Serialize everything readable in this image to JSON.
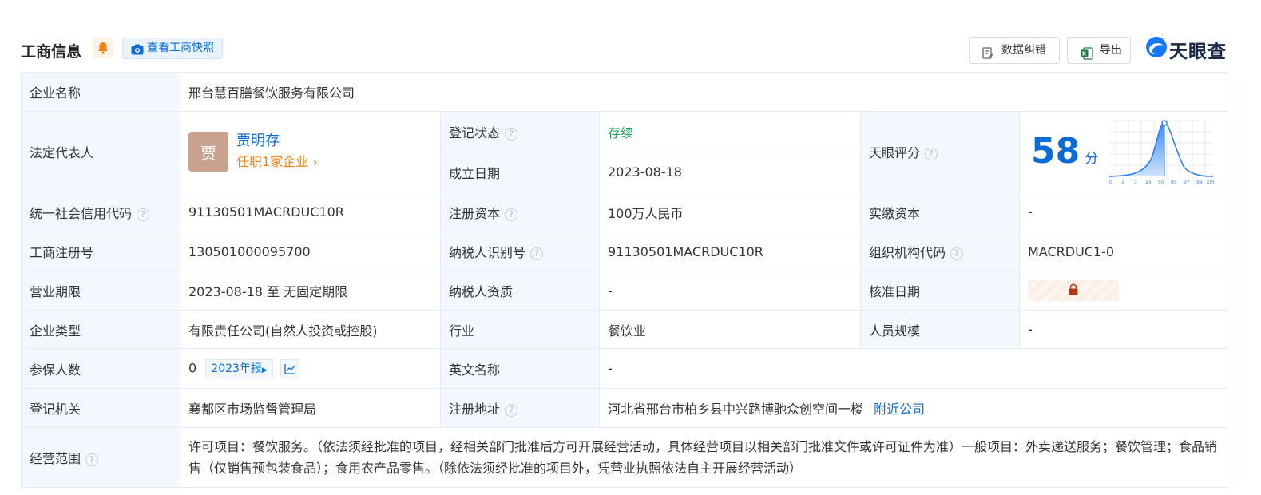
{
  "header": {
    "title": "工商信息",
    "snapshot_label": "查看工商快照",
    "fix_label": "数据纠错",
    "export_label": "导出",
    "logo_text": "天眼查"
  },
  "fields": {
    "company_name_label": "企业名称",
    "company_name": "邢台慧百膳餐饮服务有限公司",
    "legal_rep_label": "法定代表人",
    "legal_rep_avatar": "贾",
    "legal_rep_name": "贾明存",
    "legal_rep_jobs": "任职1家企业",
    "reg_status_label": "登记状态",
    "reg_status": "存续",
    "found_date_label": "成立日期",
    "found_date": "2023-08-18",
    "score_label": "天眼评分",
    "score_value": "58",
    "score_unit": "分",
    "credit_code_label": "统一社会信用代码",
    "credit_code": "91130501MACRDUC10R",
    "reg_capital_label": "注册资本",
    "reg_capital": "100万人民币",
    "paid_capital_label": "实缴资本",
    "paid_capital": "-",
    "reg_no_label": "工商注册号",
    "reg_no": "130501000095700",
    "taxpayer_id_label": "纳税人识别号",
    "taxpayer_id": "91130501MACRDUC10R",
    "org_code_label": "组织机构代码",
    "org_code": "MACRDUC1-0",
    "term_label": "营业期限",
    "term": "2023-08-18 至 无固定期限",
    "tax_qual_label": "纳税人资质",
    "tax_qual": "-",
    "approve_date_label": "核准日期",
    "company_type_label": "企业类型",
    "company_type": "有限责任公司(自然人投资或控股)",
    "industry_label": "行业",
    "industry": "餐饮业",
    "staff_size_label": "人员规模",
    "staff_size": "-",
    "insured_label": "参保人数",
    "insured": "0",
    "insured_report": "2023年报",
    "english_name_label": "英文名称",
    "english_name": "-",
    "authority_label": "登记机关",
    "authority": "襄都区市场监督管理局",
    "address_label": "注册地址",
    "address": "河北省邢台市柏乡县中兴路博驰众创空间一楼",
    "nearby_label": "附近公司",
    "scope_label": "经营范围",
    "scope": "许可项目：餐饮服务。（依法须经批准的项目，经相关部门批准后方可开展经营活动，具体经营项目以相关部门批准文件或许可证件为准）一般项目：外卖递送服务；餐饮管理；食品销售（仅销售预包装食品）；食用农产品零售。（除依法须经批准的项目外，凭营业执照依法自主开展经营活动）"
  },
  "score_chart": {
    "x_ticks": [
      "0",
      "1",
      "3",
      "15",
      "50",
      "85",
      "97",
      "99",
      "100"
    ]
  },
  "colors": {
    "accent": "#0b6bd8",
    "status_green": "#21a35a",
    "orange": "#f28218",
    "label_bg": "#f3f8fe"
  },
  "icons": [
    "bell-icon",
    "camera-icon",
    "edit-doc-icon",
    "excel-icon",
    "tianyancha-logo-icon",
    "help-icon",
    "trend-chart-icon",
    "lock-icon"
  ]
}
